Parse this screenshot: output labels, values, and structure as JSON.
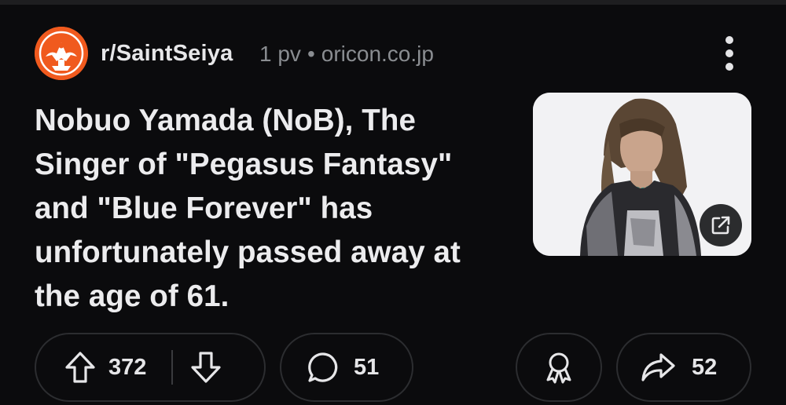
{
  "post": {
    "subreddit": "r/SaintSeiya",
    "age": "1 pv",
    "separator": "•",
    "domain": "oricon.co.jp",
    "title": "Nobuo Yamada (NoB), The Singer of \"Pegasus Fantasy\" and \"Blue Forever\" has unfortunately passed away at the age of 61."
  },
  "actions": {
    "score": "372",
    "comments": "51",
    "shares": "52"
  },
  "icons": {
    "more": "more-vertical-icon",
    "external": "external-link-icon",
    "upvote": "upvote-arrow-icon",
    "downvote": "downvote-arrow-icon",
    "comment": "comment-bubble-icon",
    "award": "award-icon",
    "share": "share-arrow-icon"
  },
  "colors": {
    "background": "#0b0b0d",
    "avatar": "#f05a1e",
    "muted_text": "#8a8d91",
    "pill_border": "#2c2d30"
  }
}
